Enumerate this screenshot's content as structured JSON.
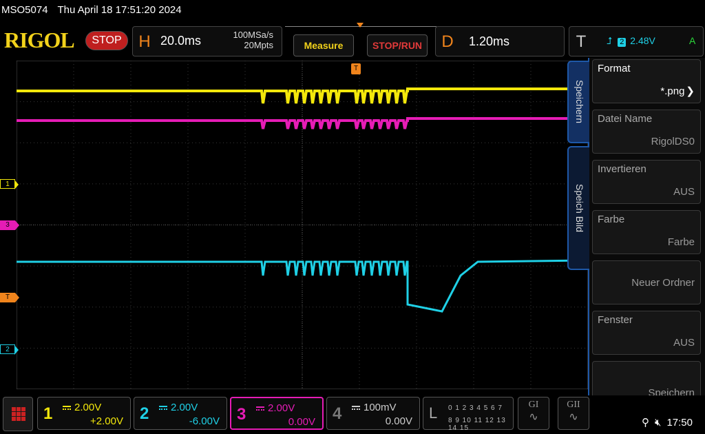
{
  "title_bar": {
    "model": "MSO5074",
    "datetime": "Thu April 18 17:51:20 2024"
  },
  "brand": {
    "logo": "RIGOL",
    "run_state": "STOP"
  },
  "horizontal": {
    "letter": "H",
    "timebase": "20.0ms",
    "sample_rate": "100MSa/s",
    "memory_depth": "20Mpts"
  },
  "buttons": {
    "measure": "Measure",
    "stop_run": "STOP/RUN"
  },
  "delay": {
    "letter": "D",
    "value": "1.20ms"
  },
  "trigger": {
    "letter": "T",
    "source": "2",
    "level": "2.48V",
    "mode": "A",
    "marker": "T"
  },
  "channel_markers": {
    "ch1": "1",
    "ch3": "3",
    "trig": "T",
    "ch2": "2"
  },
  "side_panel": {
    "tabs": [
      "Speichern",
      "Speich Bild"
    ],
    "items": [
      {
        "label": "Format",
        "value": "*.png"
      },
      {
        "label": "Datei Name",
        "value": "RigolDS0"
      },
      {
        "label": "Invertieren",
        "value": "AUS"
      },
      {
        "label": "Farbe",
        "value": "Farbe"
      },
      {
        "label": "",
        "value": "Neuer Ordner"
      },
      {
        "label": "Fenster",
        "value": "AUS"
      },
      {
        "label": "",
        "value": "Speichern"
      }
    ]
  },
  "channels": [
    {
      "num": "1",
      "scale": "2.00V",
      "offset": "+2.00V",
      "color": "#f2e70b"
    },
    {
      "num": "2",
      "scale": "2.00V",
      "offset": "-6.00V",
      "color": "#1fd0e6"
    },
    {
      "num": "3",
      "scale": "2.00V",
      "offset": "0.00V",
      "color": "#e51cb5"
    },
    {
      "num": "4",
      "scale": "100mV",
      "offset": "0.00V",
      "color": "#777777"
    }
  ],
  "logic": {
    "letter": "L",
    "row1": "0 1 2 3  4 5 6 7",
    "row2": "8 9 10 11 12 13 14 15"
  },
  "generators": [
    {
      "label": "GI"
    },
    {
      "label": "GII"
    }
  ],
  "status": {
    "time": "17:50"
  },
  "colors": {
    "ch1": "#f2e70b",
    "ch2": "#1fd0e6",
    "ch3": "#e51cb5",
    "trigger": "#f0841c",
    "accent": "#1e58a8"
  }
}
